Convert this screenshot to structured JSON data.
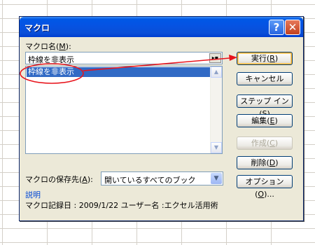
{
  "dialog": {
    "title": "マクロ",
    "help_btn": "?",
    "close_btn": "✕"
  },
  "macro_name": {
    "label_pre": "マクロ名(",
    "label_key": "M",
    "label_post": "):",
    "value": "枠線を非表示",
    "collapse_icon": "▸▪"
  },
  "macro_list": {
    "items": [
      "枠線を非表示"
    ],
    "scroll_up": "▲",
    "scroll_down": "▼"
  },
  "buttons": {
    "run": {
      "pre": "実行(",
      "key": "R",
      "post": ")"
    },
    "cancel": {
      "label": "キャンセル"
    },
    "step_in": {
      "pre": "ステップ イン(",
      "key": "S",
      "post": ")"
    },
    "edit": {
      "pre": "編集(",
      "key": "E",
      "post": ")"
    },
    "create": {
      "pre": "作成(",
      "key": "C",
      "post": ")"
    },
    "delete": {
      "pre": "削除(",
      "key": "D",
      "post": ")"
    },
    "options": {
      "pre": "オプション(",
      "key": "O",
      "post": ")..."
    }
  },
  "store_in": {
    "label_pre": "マクロの保存先(",
    "label_key": "A",
    "label_post": "):",
    "value": "開いているすべてのブック",
    "dropdown_icon": "▼"
  },
  "description": {
    "label": "説明",
    "text": "マクロ記録日 : 2009/1/22  ユーザー名 :エクセル活用術"
  },
  "colors": {
    "annotation": "#e8141c",
    "selection": "#316ac5",
    "titlebar": "#0553e3"
  }
}
